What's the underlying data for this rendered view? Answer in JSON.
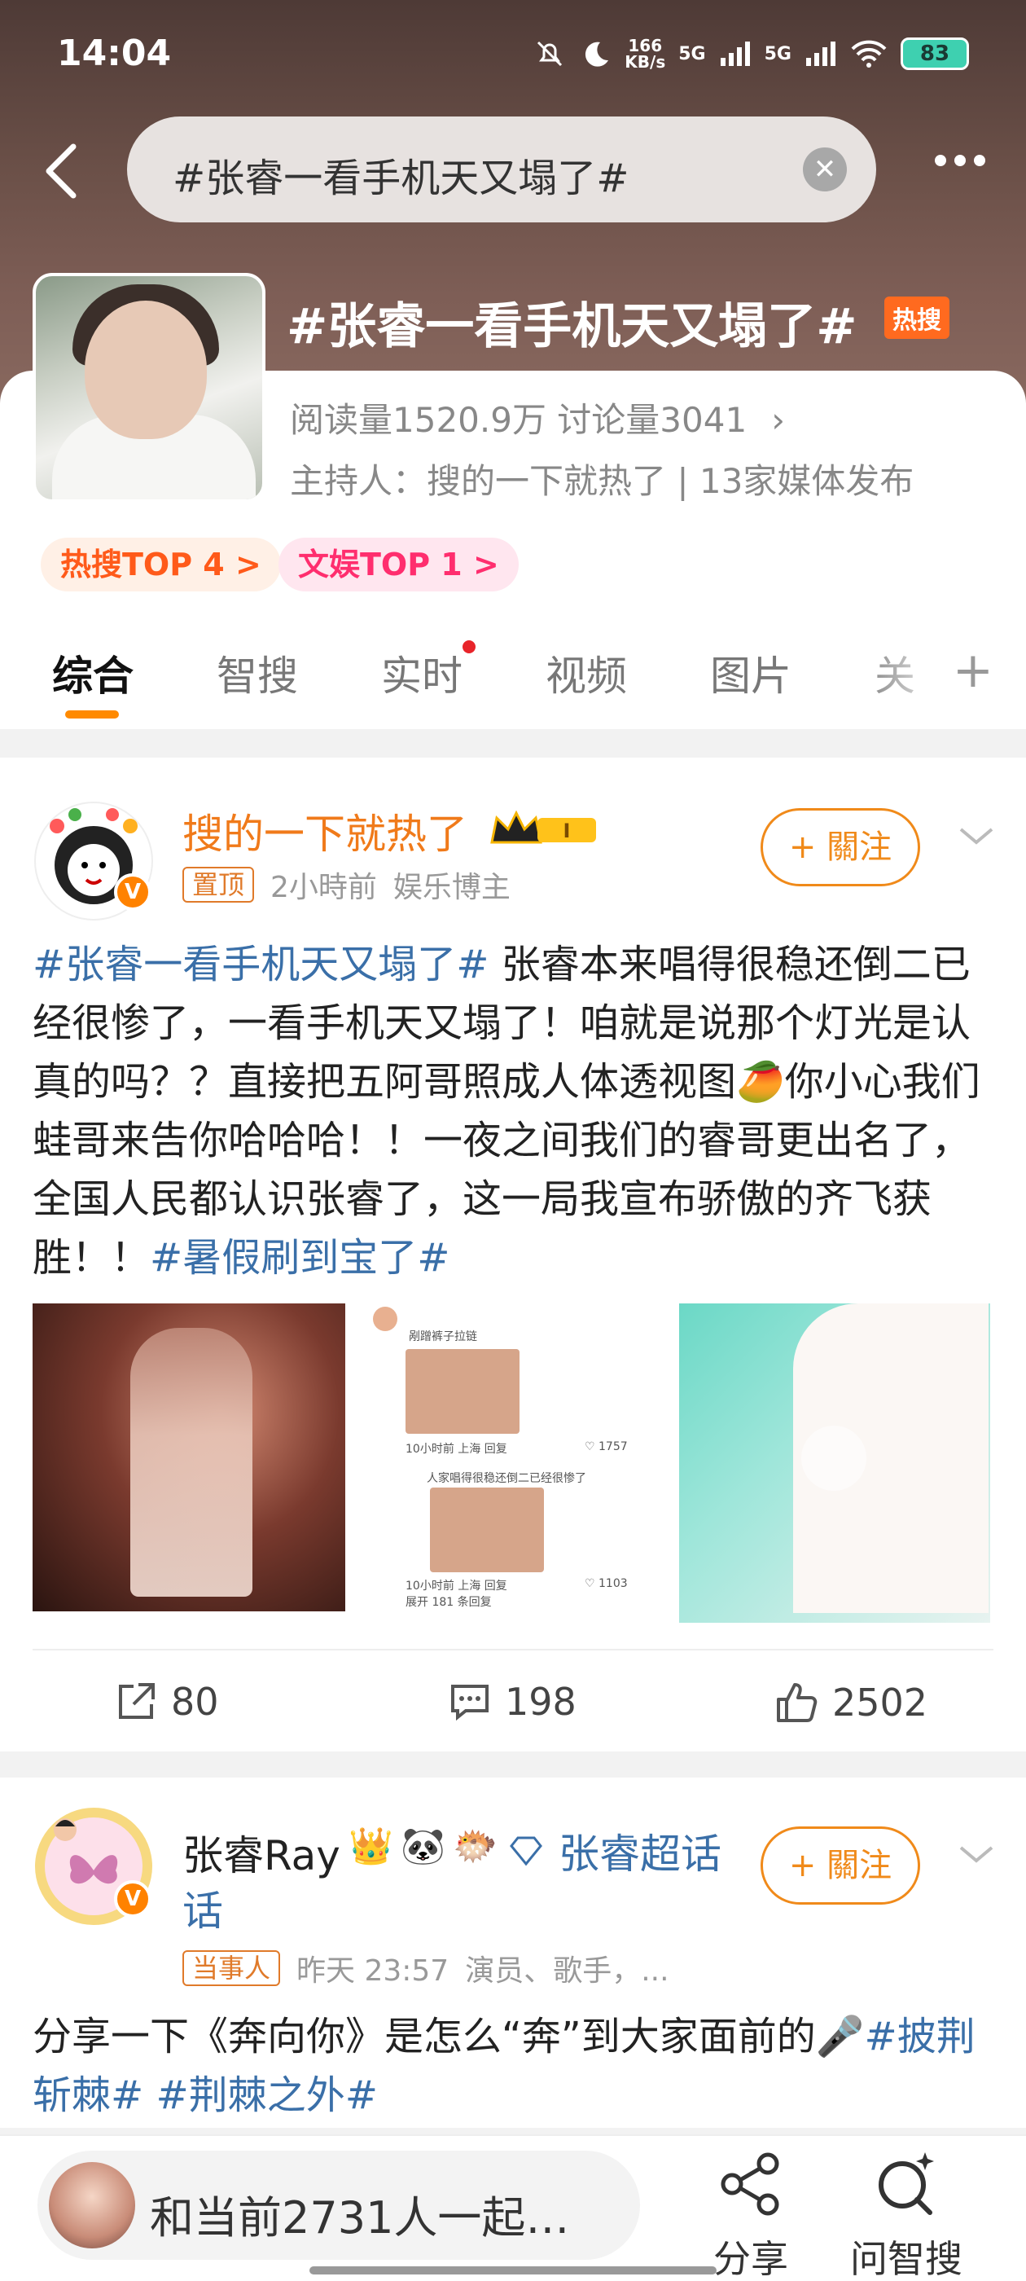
{
  "status_bar": {
    "time": "14:04",
    "speed_value": "166",
    "speed_unit": "KB/s",
    "net1": "5G",
    "net2": "5G",
    "battery": "83"
  },
  "search": {
    "query": "#张睿一看手机天又塌了#"
  },
  "topic": {
    "title": "#张睿一看手机天又塌了#",
    "hot_badge": "热搜",
    "stats": "阅读量1520.9万  讨论量3041",
    "host": "主持人：搜的一下就热了 | 13家媒体发布",
    "chips": [
      "热搜TOP 4 >",
      "文娱TOP 1 >"
    ]
  },
  "tabs": [
    {
      "label": "综合",
      "active": true
    },
    {
      "label": "智搜",
      "active": false
    },
    {
      "label": "实时",
      "active": false,
      "dot": true
    },
    {
      "label": "视频",
      "active": false
    },
    {
      "label": "图片",
      "active": false
    },
    {
      "label": "关",
      "active": false
    }
  ],
  "post1": {
    "user": "搜的一下就热了",
    "level": "I",
    "v_badge": "V",
    "pin_tag": "置顶",
    "time": "2小時前",
    "role": "娱乐博主",
    "follow": "+ 關注",
    "content_hash1": "#张睿一看手机天又塌了#",
    "content_text": " 张睿本来唱得很稳还倒二已经很惨了，一看手机天又塌了！咱就是说那个灯光是认真的吗？？直接把五阿哥照成人体透视图🥭你小心我们蛙哥来告你哈哈哈！！一夜之间我们的睿哥更出名了，全国人民都认识张睿了，这一局我宣布骄傲的齐飞获胜！！",
    "content_hash2": "#暑假刷到宝了#",
    "screenshot": {
      "line1": "剐蹭裤子拉链",
      "meta1": "10小时前 上海  回复",
      "likes1": "♡ 1757",
      "line2": "人家唱得很稳还倒二已经很惨了",
      "meta2": "10小时前 上海  回复",
      "likes2": "♡ 1103",
      "more": "展开 181 条回复"
    },
    "reposts": "80",
    "comments": "198",
    "likes": "2502"
  },
  "post2": {
    "user": "张睿Ray",
    "super_topic": "张睿超话",
    "v_badge": "V",
    "tag": "当事人",
    "time": "昨天 23:57",
    "role": "演员、歌手，...",
    "follow": "+ 關注",
    "content_text": "分享一下《奔向你》是怎么“奔”到大家面前的🎤",
    "content_hash1": "#披荆斩棘#",
    "content_hash2": "#荆棘之外#"
  },
  "bottom_bar": {
    "live_text": "和当前2731人一起…",
    "share": "分享",
    "ask": "问智搜"
  },
  "colors": {
    "accent": "#ff8200",
    "link": "#3a6fa8",
    "hot": "#ff6a1f"
  }
}
